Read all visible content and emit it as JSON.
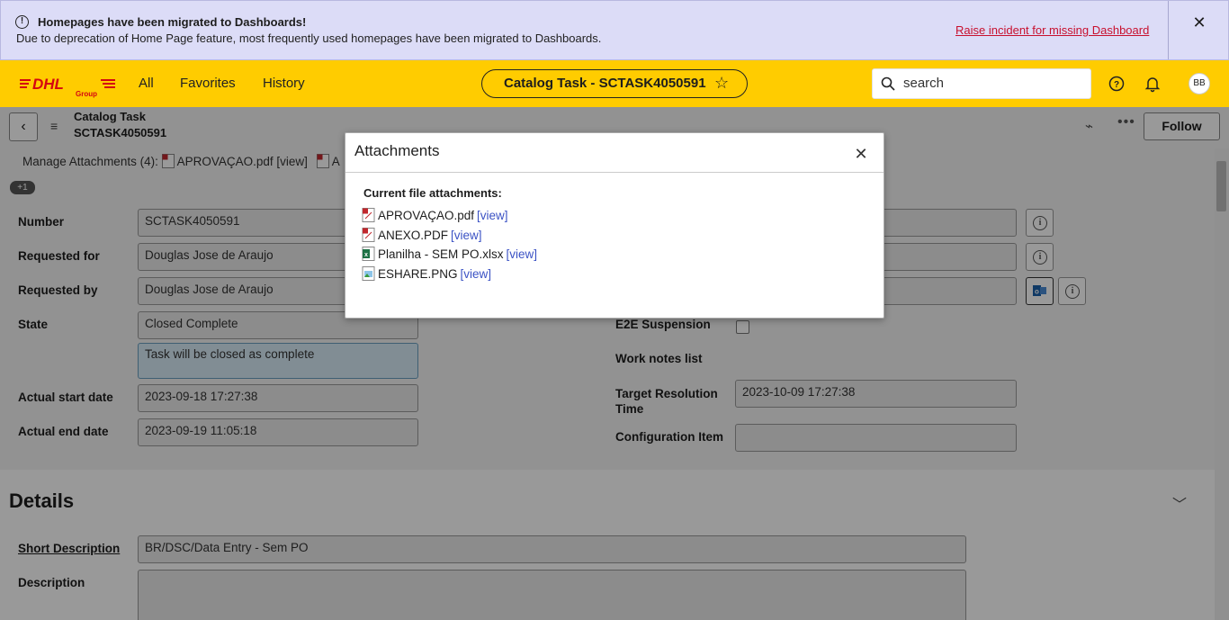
{
  "banner": {
    "title": "Homepages have been migrated to Dashboards!",
    "message": "Due to deprecation of Home Page feature, most frequently used homepages have been migrated to Dashboards.",
    "link": "Raise incident for missing Dashboard",
    "close_icon": "✕"
  },
  "header": {
    "logo_text": "DHL",
    "logo_sub": "Group",
    "nav": [
      "All",
      "Favorites",
      "History"
    ],
    "record_title": "Catalog Task - SCTASK4050591",
    "star": "☆",
    "search_placeholder": "search",
    "avatar": "BB"
  },
  "toolbar": {
    "title_line1": "Catalog Task",
    "title_line2": "SCTASK4050591",
    "follow": "Follow",
    "more": "•••"
  },
  "attachments_line": {
    "prefix": "Manage Attachments (4):",
    "first_file": "APROVAÇAO.pdf",
    "first_view": "[view]",
    "next_initial": "A",
    "badge": "+1"
  },
  "fields_left": [
    {
      "label": "Number",
      "value": "SCTASK4050591"
    },
    {
      "label": "Requested for",
      "value": "Douglas Jose de Araujo"
    },
    {
      "label": "Requested by",
      "value": "Douglas Jose de Araujo"
    },
    {
      "label": "State",
      "value": "Closed Complete"
    },
    {
      "label": "",
      "value": "Task will be closed as complete"
    },
    {
      "label": "Actual start date",
      "value": "2023-09-18 17:27:38"
    },
    {
      "label": "Actual end date",
      "value": "2023-09-19 11:05:18"
    }
  ],
  "fields_right": [
    {
      "label": "E2E Suspension",
      "value": ""
    },
    {
      "label": "Work notes list",
      "value": ""
    },
    {
      "label": "Target Resolution Time",
      "value": "2023-10-09 17:27:38"
    },
    {
      "label": "Configuration Item",
      "value": ""
    }
  ],
  "details": {
    "title": "Details",
    "short_description_label": "Short Description",
    "short_description_value": "BR/DSC/Data Entry - Sem PO",
    "description_label": "Description"
  },
  "modal": {
    "title": "Attachments",
    "subtitle": "Current file attachments:",
    "files": [
      {
        "name": "APROVAÇAO.pdf",
        "view": "[view]",
        "icon": "pdf-icon"
      },
      {
        "name": "ANEXO.PDF",
        "view": "[view]",
        "icon": "pdf-icon"
      },
      {
        "name": "Planilha - SEM PO.xlsx",
        "view": "[view]",
        "icon": "excel-icon"
      },
      {
        "name": "ESHARE.PNG",
        "view": "[view]",
        "icon": "image-icon"
      }
    ]
  },
  "colors": {
    "brand_yellow": "#ffcc00",
    "brand_red": "#d40511",
    "banner_bg": "#dcdcf7",
    "link_blue": "#3b52c4"
  }
}
